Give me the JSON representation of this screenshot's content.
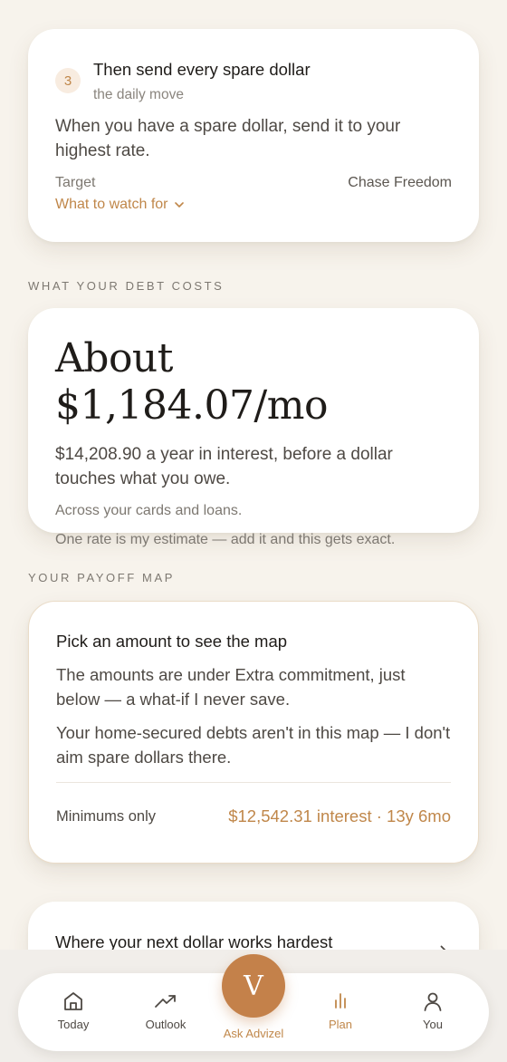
{
  "step_card": {
    "number": "3",
    "title": "Then send every spare dollar",
    "subtitle": "the daily move",
    "body": "When you have a spare dollar, send it to your highest rate.",
    "target_label": "Target",
    "target_value": "Chase Freedom",
    "watch_link": "What to watch for"
  },
  "debt_costs": {
    "section_label": "WHAT YOUR DEBT COSTS",
    "amount": "About $1,184.07/mo",
    "line1": "$14,208.90 a year in interest, before a dollar touches what you owe.",
    "line2": "Across your cards and loans.",
    "line3": "One rate is my estimate — add it and this gets exact."
  },
  "payoff_map": {
    "section_label": "YOUR PAYOFF MAP",
    "title": "Pick an amount to see the map",
    "body1": "The amounts are under Extra commitment, just below — a what-if I never save.",
    "body2": "Your home-secured debts aren't in this map — I don't aim spare dollars there.",
    "row_label": "Minimums only",
    "row_value": "$12,542.31 interest · 13y 6mo"
  },
  "next_card": {
    "title": "Where your next dollar works hardest"
  },
  "nav": {
    "today": "Today",
    "outlook": "Outlook",
    "ask_initial": "V",
    "ask": "Ask Advizel",
    "plan": "Plan",
    "you": "You"
  },
  "colors": {
    "accent": "#c0874a",
    "background": "#f7f3ec",
    "card": "#ffffff"
  }
}
